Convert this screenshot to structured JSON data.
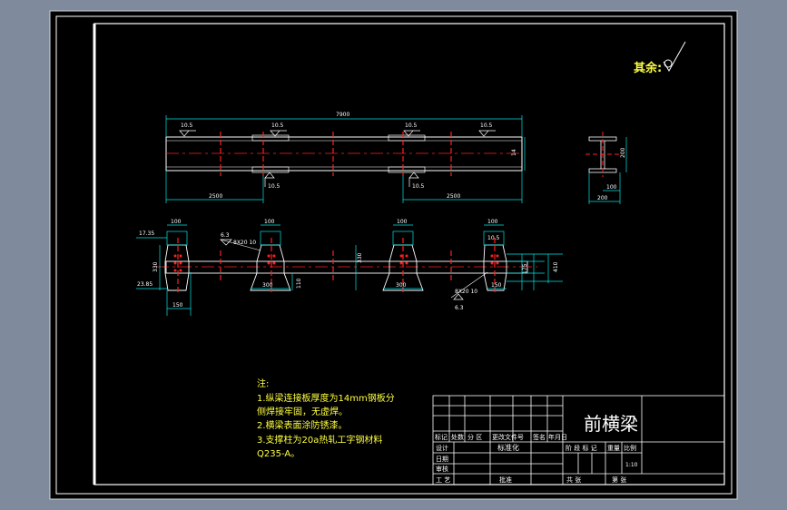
{
  "roughness": {
    "label": "其余:"
  },
  "top_view": {
    "overall_length": "7900",
    "height_dim": "14",
    "left_span": "2500",
    "right_span": "2500",
    "weld_sizes": [
      "10.5",
      "10.5",
      "10.5",
      "10.5"
    ],
    "weld_sizes_bottom": [
      "10.5",
      "10.5"
    ]
  },
  "section_view": {
    "height_dim": "200",
    "width_dim": "100",
    "bottom_dim": "200"
  },
  "front_view": {
    "dims_top": [
      "100",
      "100",
      "100",
      "100"
    ],
    "left_offset": "17.35",
    "left_offset2": "23.85",
    "left_bottom": "150",
    "left_height": "330",
    "mid_bottom1": "300",
    "mid_bottom2": "300",
    "mid_small": "110",
    "mid_height": "330",
    "right_bottom": "150",
    "right_height": "410",
    "weld_note1": "6.3",
    "weld_label1": "8X20 10",
    "weld_note2": "6.3",
    "weld_label2": "8X20 10",
    "small_label": "10.5",
    "right_small": "175"
  },
  "notes": {
    "title": "注:",
    "lines": [
      "1.纵梁连接板厚度为14mm钢板分",
      "  侧焊接牢固，无虚焊。",
      "2.横梁表面涂防锈漆。",
      "3.支撑柱为20a热轧工字钢材料",
      "  Q235-A。"
    ]
  },
  "title_block": {
    "part_name": "前横梁",
    "row_labels": [
      "标记",
      "处数",
      "分 区",
      "更改文件号",
      "签名",
      "年月日"
    ],
    "designer_label": "设计",
    "standardization_label": "标准化",
    "stage_label": "阶 段 标 记",
    "weight_label": "重量",
    "scale_label": "比例",
    "scale_value": "1:10",
    "date_label": "日期",
    "review_label": "审核",
    "process_label": "工 艺",
    "approve_label": "批准",
    "total_sheets": "共  张",
    "sheet_no": "第  张"
  },
  "colors": {
    "frame_bg": "#000000",
    "outer_bg": "#7f8a9c",
    "line_white": "#ffffff",
    "center_red": "#ff2020",
    "dim_cyan": "#00e5e5",
    "note_yellow": "#ffff40"
  }
}
